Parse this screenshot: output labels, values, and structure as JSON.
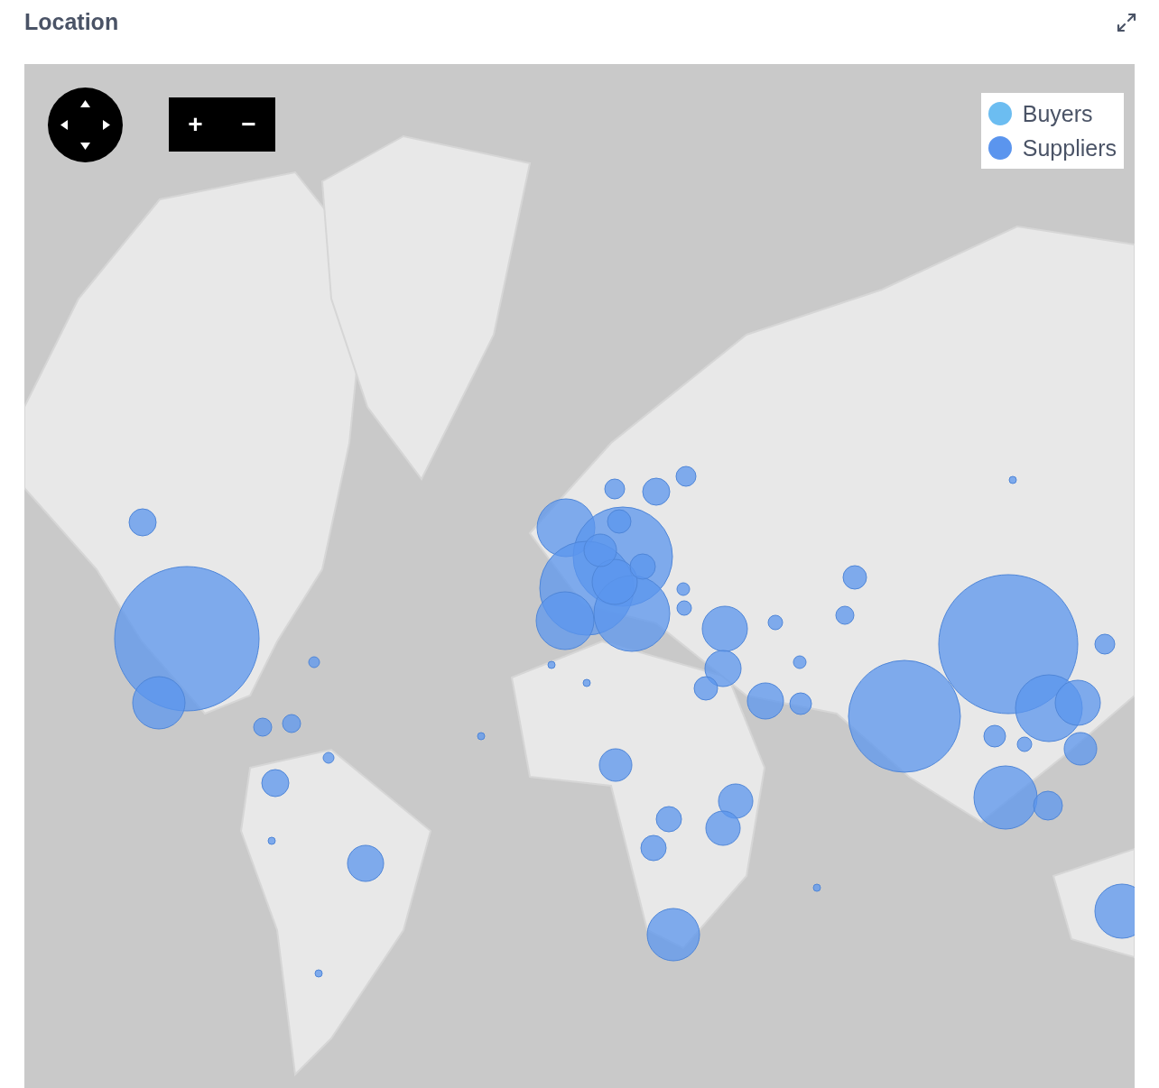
{
  "title": "Location",
  "map": {
    "zoom_buttons": [
      "+",
      "−"
    ],
    "legend": [
      {
        "label": "Buyers",
        "color": "#6cbdf1"
      },
      {
        "label": "Suppliers",
        "color": "#5b95ee"
      }
    ]
  }
}
